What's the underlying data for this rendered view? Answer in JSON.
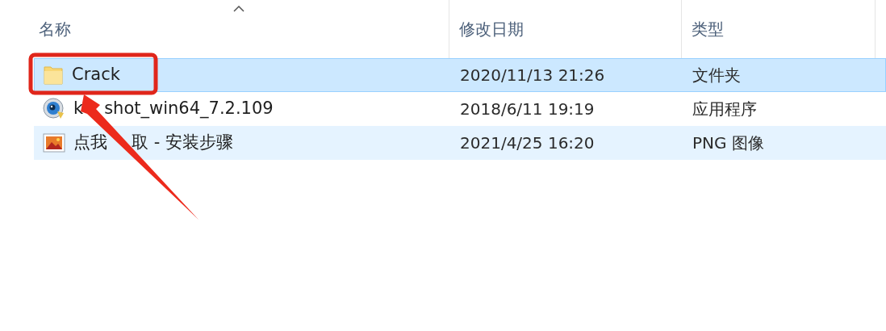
{
  "columns": [
    {
      "label": "名称",
      "sorted": true
    },
    {
      "label": "修改日期",
      "sorted": false
    },
    {
      "label": "类型",
      "sorted": false
    }
  ],
  "files": [
    {
      "kind": "folder",
      "name": [
        "Crack"
      ],
      "modified": "2020/11/13 21:26",
      "type": "文件夹",
      "selected": true,
      "hovered": false
    },
    {
      "kind": "app",
      "name": [
        "k",
        "shot_win64_7.2.109"
      ],
      "modified": "2018/6/11 19:19",
      "type": "应用程序",
      "selected": false,
      "hovered": false
    },
    {
      "kind": "image",
      "name": [
        "点我",
        "取 - 安装步骤"
      ],
      "modified": "2021/4/25 16:20",
      "type": "PNG 图像",
      "selected": false,
      "hovered": true
    }
  ]
}
